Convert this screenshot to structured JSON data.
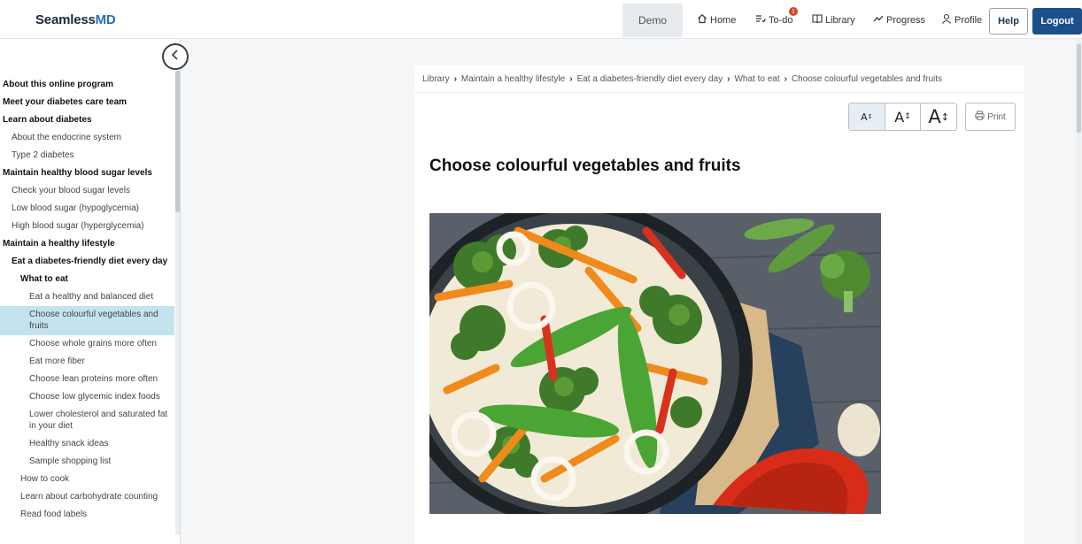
{
  "app": {
    "logo_main": "Seamless",
    "logo_accent": "MD"
  },
  "topnav": {
    "demo": "Demo",
    "home": "Home",
    "todo": "To-do",
    "todo_badge": "1",
    "library": "Library",
    "progress": "Progress",
    "profile": "Profile",
    "help": "Help",
    "logout": "Logout"
  },
  "sidebar": {
    "items": [
      {
        "label": "About this online program",
        "level": 0,
        "bold": true
      },
      {
        "label": "Meet your diabetes care team",
        "level": 0,
        "bold": true
      },
      {
        "label": "Learn about diabetes",
        "level": 0,
        "bold": true
      },
      {
        "label": "About the endocrine system",
        "level": 1
      },
      {
        "label": "Type 2 diabetes",
        "level": 1
      },
      {
        "label": "Maintain healthy blood sugar levels",
        "level": 0,
        "bold": true
      },
      {
        "label": "Check your blood sugar levels",
        "level": 1
      },
      {
        "label": "Low blood sugar (hypoglycemia)",
        "level": 1
      },
      {
        "label": "High blood sugar (hyperglycemia)",
        "level": 1
      },
      {
        "label": "Maintain a healthy lifestyle",
        "level": 0,
        "bold": true
      },
      {
        "label": "Eat a diabetes-friendly diet every day",
        "level": 1,
        "bold": true
      },
      {
        "label": "What to eat",
        "level": 2,
        "bold": true
      },
      {
        "label": "Eat a healthy and balanced diet",
        "level": 3
      },
      {
        "label": "Choose colourful vegetables and fruits",
        "level": 3,
        "active": true
      },
      {
        "label": "Choose whole grains more often",
        "level": 3
      },
      {
        "label": "Eat more fiber",
        "level": 3
      },
      {
        "label": "Choose lean proteins more often",
        "level": 3
      },
      {
        "label": "Choose low glycemic index foods",
        "level": 3
      },
      {
        "label": "Lower cholesterol and saturated fat in your diet",
        "level": 3
      },
      {
        "label": "Healthy snack ideas",
        "level": 3
      },
      {
        "label": "Sample shopping list",
        "level": 3
      },
      {
        "label": "How to cook",
        "level": 2
      },
      {
        "label": "Learn about carbohydrate counting",
        "level": 2
      },
      {
        "label": "Read food labels",
        "level": 2
      }
    ]
  },
  "breadcrumb": [
    "Library",
    "Maintain a healthy lifestyle",
    "Eat a diabetes-friendly diet every day",
    "What to eat",
    "Choose colourful vegetables and fruits"
  ],
  "toolbar": {
    "print": "Print",
    "font_glyph": "A"
  },
  "content": {
    "title": "Choose colourful vegetables and fruits"
  },
  "colors": {
    "brand_dark": "#1d4f8b",
    "active_item": "#c3e4ee",
    "badge": "#d2452c"
  },
  "icons": [
    "home-icon",
    "todo-icon",
    "library-icon",
    "progress-icon",
    "profile-icon",
    "chevron-left-icon",
    "print-icon"
  ]
}
